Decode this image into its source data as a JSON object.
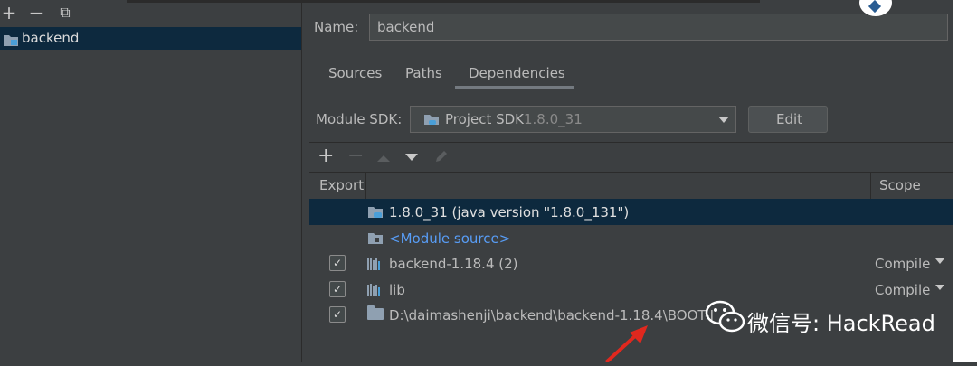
{
  "left_toolbar": {
    "add_label": "+",
    "remove_label": "−",
    "copy_label": "⧉"
  },
  "tree": {
    "items": [
      {
        "label": "backend"
      }
    ]
  },
  "name_field": {
    "label": "Name:",
    "value": "backend"
  },
  "tabs": [
    {
      "label": "Sources"
    },
    {
      "label": "Paths"
    },
    {
      "label": "Dependencies"
    }
  ],
  "module_sdk": {
    "label": "Module SDK:",
    "selected": "Project SDK",
    "version": "1.8.0_31",
    "edit_label": "Edit"
  },
  "dep_toolbar": {
    "add": "+",
    "remove": "−"
  },
  "table": {
    "headers": {
      "export": "Export",
      "scope": "Scope"
    },
    "rows": [
      {
        "text": "1.8.0_31 (java version \"1.8.0_131\")",
        "checked": false,
        "scope": ""
      },
      {
        "text": "<Module source>",
        "checked": false,
        "scope": ""
      },
      {
        "text": "backend-1.18.4 (2)",
        "checked": true,
        "scope": "Compile"
      },
      {
        "text": "lib",
        "checked": true,
        "scope": "Compile"
      },
      {
        "text": "D:\\daimashenji\\backend\\backend-1.18.4\\BOOT-I",
        "checked": true,
        "scope": ""
      }
    ]
  },
  "watermark": {
    "text": "微信号: HackRead"
  },
  "colors": {
    "selection": "#0d293e",
    "link": "#589df6",
    "accent_underline": "#4a88c7",
    "arrow": "#e0281e"
  }
}
